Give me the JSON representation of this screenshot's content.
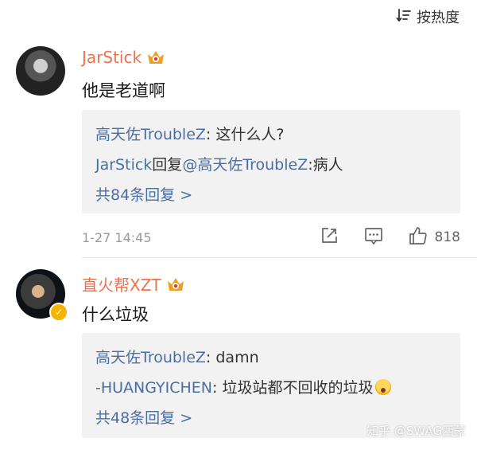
{
  "sort": {
    "label": "按热度"
  },
  "comments": [
    {
      "username": "JarStick",
      "text": "他是老道啊",
      "replies": [
        {
          "author": "高天佐TroubleZ",
          "sep": ": ",
          "text": "这什么人?"
        },
        {
          "author": "JarStick",
          "mid": "回复",
          "target": "@高天佐TroubleZ",
          "sep": ":",
          "text": "病人"
        }
      ],
      "more_replies": "共84条回复 >",
      "time": "1-27 14:45",
      "likes": "818"
    },
    {
      "username": "直火帮XZT",
      "text": "什么垃圾",
      "replies": [
        {
          "author": "高天佐TroubleZ",
          "sep": ": ",
          "text": "damn"
        },
        {
          "author": "-HUANGYICHEN",
          "sep": ": ",
          "text": "垃圾站都不回收的垃圾"
        }
      ],
      "more_replies": "共48条回复 >"
    }
  ],
  "watermark": "知乎 @SWAG西蒙",
  "colors": {
    "username": "#eb7350",
    "link": "#4a6ea3",
    "reply_bg": "#f2f2f2",
    "crown": "#f0a020"
  },
  "icons": [
    "sort-icon",
    "vip-crown-icon",
    "share-icon",
    "comment-icon",
    "like-icon",
    "verified-badge-icon",
    "emoji-scream-icon"
  ]
}
